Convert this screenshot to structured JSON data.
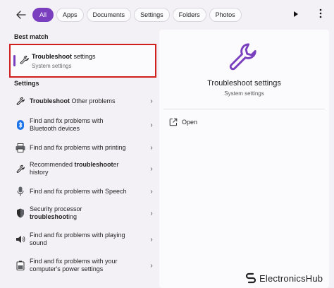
{
  "filters": {
    "back_icon": "arrow-left-icon",
    "chips": [
      {
        "label": "All",
        "active": true
      },
      {
        "label": "Apps",
        "active": false
      },
      {
        "label": "Documents",
        "active": false
      },
      {
        "label": "Settings",
        "active": false
      },
      {
        "label": "Folders",
        "active": false
      },
      {
        "label": "Photos",
        "active": false
      }
    ],
    "play_icon": "play-icon",
    "more_icon": "more-icon"
  },
  "left": {
    "best_match_title": "Best match",
    "best_match": {
      "title_bold": "Troubleshoot",
      "title_rest": " settings",
      "subtitle": "System settings",
      "icon": "wrench-icon"
    },
    "settings_title": "Settings",
    "items": [
      {
        "icon": "wrench-icon",
        "bold": "Troubleshoot",
        "text": " Other problems",
        "line2": ""
      },
      {
        "icon": "bluetooth-icon",
        "bold": "",
        "text": "Find and fix problems with",
        "line2": "Bluetooth devices"
      },
      {
        "icon": "printer-icon",
        "bold": "",
        "text": "Find and fix problems with printing",
        "line2": ""
      },
      {
        "icon": "wrench-icon",
        "bold": "",
        "text": "Recommended ",
        "bold2": "troubleshoot",
        "text2": "er",
        "line2": "history"
      },
      {
        "icon": "microphone-icon",
        "bold": "",
        "text": "Find and fix problems with Speech",
        "line2": ""
      },
      {
        "icon": "shield-icon",
        "bold": "",
        "text": "Security processor",
        "line2_bold": "troubleshoot",
        "line2": "ing"
      },
      {
        "icon": "speaker-icon",
        "bold": "",
        "text": "Find and fix problems with playing",
        "line2": "sound"
      },
      {
        "icon": "battery-icon",
        "bold": "",
        "text": "Find and fix problems with your",
        "line2": "computer's power settings"
      }
    ]
  },
  "right": {
    "icon": "wrench-icon",
    "title": "Troubleshoot settings",
    "subtitle": "System settings",
    "open_label": "Open",
    "open_icon": "open-external-icon"
  },
  "watermark": {
    "brand": "ElectronicsHub",
    "logo_icon": "electronicshub-logo-icon"
  },
  "colors": {
    "accent": "#7a3fbf",
    "highlight_border": "#d0201e",
    "background": "#f3f1f6",
    "panel": "#fbfafd"
  }
}
